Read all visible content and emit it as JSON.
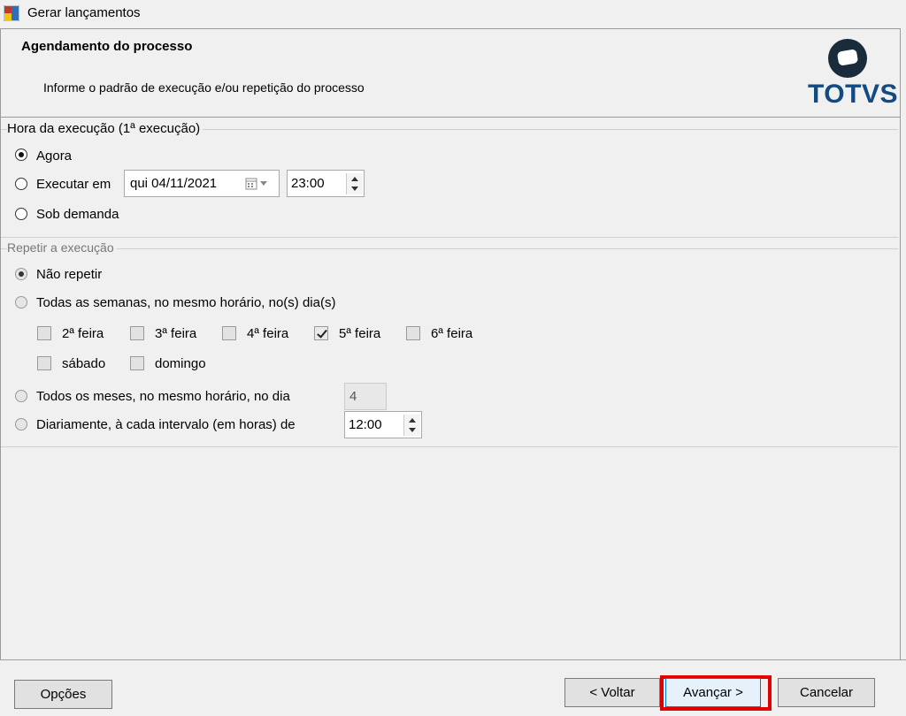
{
  "window": {
    "title": "Gerar lançamentos"
  },
  "header": {
    "title": "Agendamento do processo",
    "subtitle": "Informe o padrão de execução e/ou repetição do processo",
    "logo_text": "TOTVS"
  },
  "execution": {
    "group_title": "Hora da execução (1ª execução)",
    "options": [
      {
        "label": "Agora",
        "selected": true
      },
      {
        "label": "Executar em",
        "selected": false
      },
      {
        "label": "Sob demanda",
        "selected": false
      }
    ],
    "date_value": "qui  04/11/2021",
    "time_value": "23:00"
  },
  "repeat": {
    "group_title": "Repetir a execução",
    "options": [
      {
        "label": "Não repetir",
        "selected": true
      },
      {
        "label": "Todas as semanas, no mesmo horário, no(s) dia(s)",
        "selected": false
      },
      {
        "label": "Todos os meses, no mesmo horário, no dia",
        "selected": false
      },
      {
        "label": "Diariamente, à cada intervalo (em horas) de",
        "selected": false
      }
    ],
    "days": [
      {
        "label": "2ª feira",
        "checked": false
      },
      {
        "label": "3ª feira",
        "checked": false
      },
      {
        "label": "4ª feira",
        "checked": false
      },
      {
        "label": "5ª feira",
        "checked": true
      },
      {
        "label": "6ª feira",
        "checked": false
      },
      {
        "label": "sábado",
        "checked": false
      },
      {
        "label": "domingo",
        "checked": false
      }
    ],
    "month_day_value": "4",
    "interval_value": "12:00"
  },
  "footer": {
    "options_label": "Opções",
    "back_label": "< Voltar",
    "next_label": "Avançar >",
    "cancel_label": "Cancelar"
  },
  "colors": {
    "highlight": "#e00000",
    "logo": "#134a82"
  }
}
